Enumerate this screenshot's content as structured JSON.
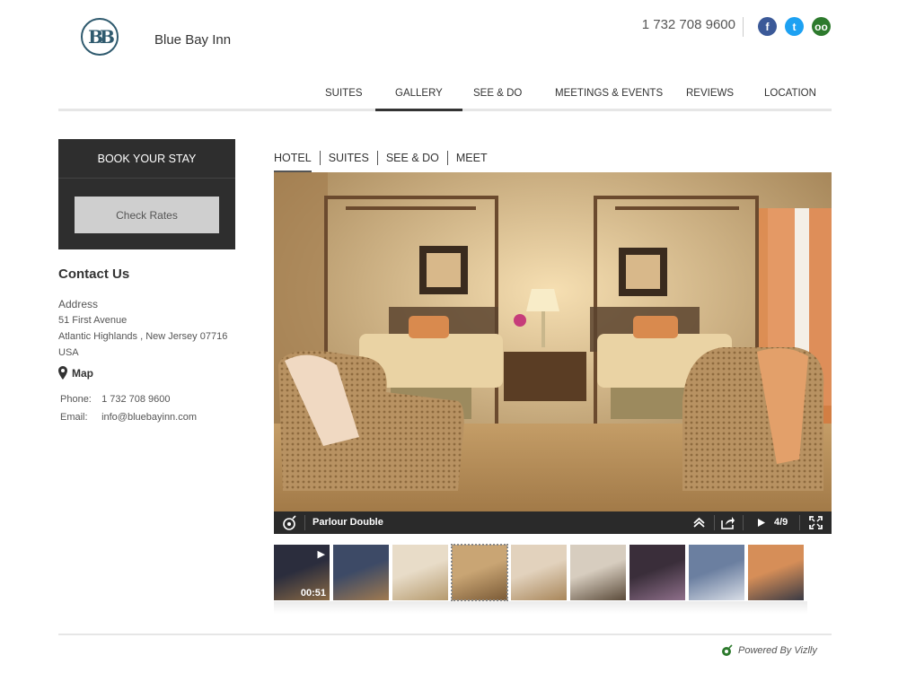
{
  "header": {
    "logo_text": "BB",
    "brand": "Blue Bay Inn",
    "phone": "1 732 708 9600",
    "socials": [
      {
        "icon": "facebook-icon",
        "glyph": "f",
        "color": "#3b5998"
      },
      {
        "icon": "twitter-icon",
        "glyph": "t",
        "color": "#1da1f2"
      },
      {
        "icon": "tripadvisor-icon",
        "glyph": "oo",
        "color": "#2d7a2d"
      }
    ]
  },
  "nav": {
    "items": [
      "SUITES",
      "GALLERY",
      "SEE & DO",
      "MEETINGS & EVENTS",
      "REVIEWS",
      "LOCATION"
    ],
    "active": "GALLERY"
  },
  "sidebar": {
    "book_title": "BOOK YOUR STAY",
    "check_rates": "Check Rates",
    "contact_title": "Contact Us",
    "address_label": "Address",
    "address_line1": "51 First Avenue",
    "address_line2": "Atlantic Highlands , New Jersey 07716",
    "address_line3": "USA",
    "map_label": "Map",
    "phone_label": "Phone:",
    "phone_value": "1 732 708 9600",
    "email_label": "Email:",
    "email_value": "info@bluebayinn.com"
  },
  "gallery": {
    "tabs": [
      "HOTEL",
      "SUITES",
      "SEE & DO",
      "MEET"
    ],
    "active_tab": "HOTEL",
    "photo_title": "Parlour Double",
    "counter": "4/9",
    "video_duration": "00:51",
    "thumbnails": [
      {
        "name": "thumb-exterior-video",
        "palette": [
          "#2b2d3d",
          "#8a6a45"
        ]
      },
      {
        "name": "thumb-exterior-evening",
        "palette": [
          "#3d4a66",
          "#a07a50"
        ]
      },
      {
        "name": "thumb-living-room",
        "palette": [
          "#e8dcc8",
          "#b59a6e"
        ]
      },
      {
        "name": "thumb-parlour-double",
        "palette": [
          "#c9a574",
          "#7a5a36"
        ]
      },
      {
        "name": "thumb-suite-bedroom",
        "palette": [
          "#e2d2bd",
          "#a8865a"
        ]
      },
      {
        "name": "thumb-kitchen",
        "palette": [
          "#d7cdbf",
          "#5b4b3a"
        ]
      },
      {
        "name": "thumb-dining",
        "palette": [
          "#3a2e3a",
          "#8e6f8a"
        ]
      },
      {
        "name": "thumb-marina",
        "palette": [
          "#6b7fa0",
          "#d8dde6"
        ]
      },
      {
        "name": "thumb-sunset",
        "palette": [
          "#d68e58",
          "#3a3a44"
        ]
      }
    ]
  },
  "footer": {
    "powered": "Powered By Vizlly"
  }
}
